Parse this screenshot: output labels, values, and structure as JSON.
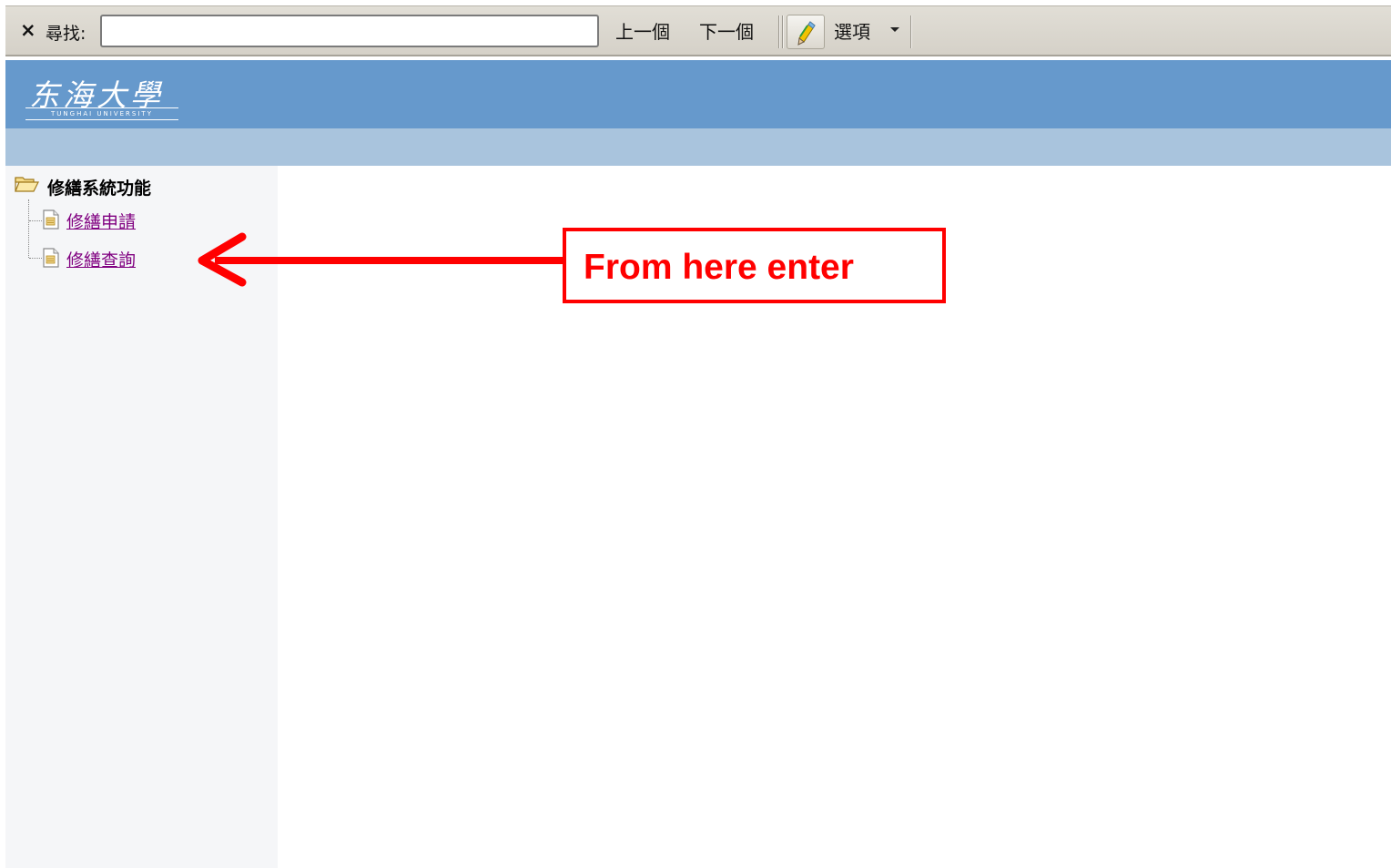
{
  "find_bar": {
    "close_glyph": "×",
    "label": "尋找:",
    "search_value": "",
    "prev_label": "上一個",
    "next_label": "下一個",
    "highlight_icon": "pencil-icon",
    "options_label": "選項"
  },
  "header": {
    "logo_cn": "东海大學",
    "logo_en": "TUNGHAI UNIVERSITY",
    "colors": {
      "header_bg": "#6699cc",
      "subbar_bg": "#a9c4dd"
    }
  },
  "sidebar": {
    "root_icon": "folder-open-icon",
    "root_label": "修繕系統功能",
    "items": [
      {
        "icon": "document-icon",
        "label": "修繕申請"
      },
      {
        "icon": "document-icon",
        "label": "修繕查詢"
      }
    ],
    "link_color": "#800080"
  },
  "annotation": {
    "text": "From here enter",
    "color": "#ff0000"
  }
}
